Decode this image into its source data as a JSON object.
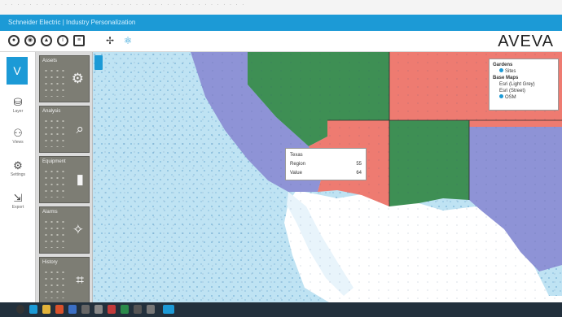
{
  "window": {
    "strip_text": "· · · · ·   · ·   · · · · ·   · · ·   · · · · · · · · ·   · · · · · ·   · · · · · ·   · · ·",
    "title": "Schneider Electric | Industry Personalization"
  },
  "toolbar": {
    "icons": [
      "user-icon",
      "user-settings-icon",
      "lock-icon",
      "info-icon",
      "document-icon",
      "share-icon",
      "translate-icon"
    ],
    "logo": "AVEVA"
  },
  "nav": {
    "active_glyph": "V",
    "items": [
      {
        "glyph": "⛁",
        "label": "Layer"
      },
      {
        "glyph": "⚇",
        "label": "Views"
      },
      {
        "glyph": "⚙",
        "label": "Settings"
      },
      {
        "glyph": "⇲",
        "label": "Export"
      }
    ]
  },
  "panel": {
    "tiles": [
      {
        "title": "Assets",
        "glyph": "⚙"
      },
      {
        "title": "Analysis",
        "glyph": "⌕"
      },
      {
        "title": "Equipment",
        "glyph": "▮"
      },
      {
        "title": "Alarms",
        "glyph": "✧"
      },
      {
        "title": "History",
        "glyph": "⌗"
      }
    ]
  },
  "map": {
    "legend": {
      "title": "Gardens",
      "item1": "Sites",
      "sub_title": "Base Maps",
      "item2": "Esri (Light Grey)",
      "item3": "Esri (Street)",
      "item4": "OSM"
    },
    "popup": {
      "title": "Texas",
      "row1_label": "Region",
      "row1_value": "55",
      "row2_label": "Value",
      "row2_value": "64"
    },
    "colors": {
      "water": "#bfe3f3",
      "purple": "#8e93d6",
      "green": "#3e8f54",
      "red": "#ee7b71",
      "land": "#ffffff",
      "accent": "#1c9ad6"
    }
  }
}
